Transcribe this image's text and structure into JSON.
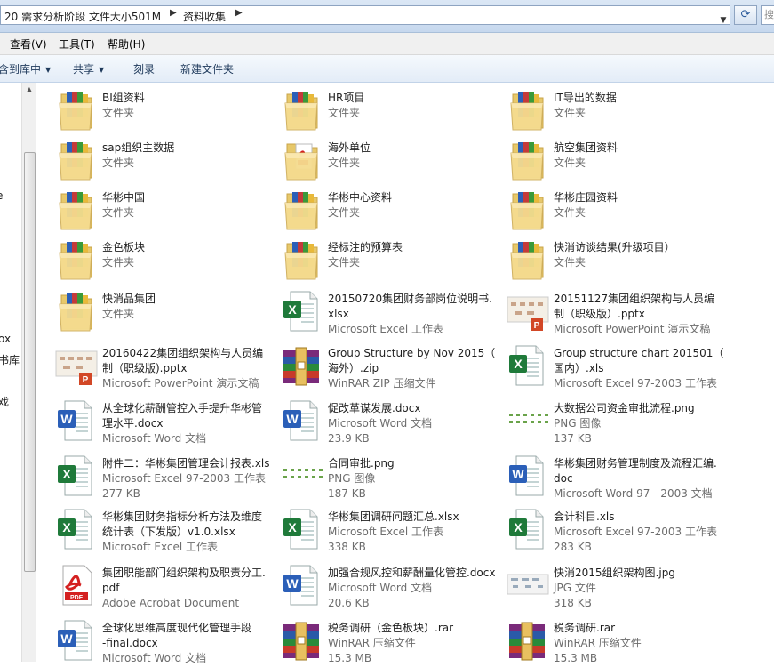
{
  "address": {
    "crumb1": "20 需求分析阶段 文件大小501M",
    "crumb2": "资料收集",
    "search_placeholder": "搜"
  },
  "menu": [
    "查看(V)",
    "工具(T)",
    "帮助(H)"
  ],
  "toolbar": {
    "include": "包含到库中",
    "share": "共享",
    "burn": "刻录",
    "new_folder": "新建文件夹"
  },
  "nav_fragments": [
    "e",
    "ox",
    "书库",
    "戏"
  ],
  "items": [
    {
      "l1": "BI组资料",
      "l2": "",
      "l3": "文件夹",
      "icon": "folder-icon"
    },
    {
      "l1": "HR项目",
      "l2": "",
      "l3": "文件夹",
      "icon": "folder-icon"
    },
    {
      "l1": "IT导出的数据",
      "l2": "",
      "l3": "文件夹",
      "icon": "folder-icon"
    },
    {
      "l1": "sap组织主数据",
      "l2": "",
      "l3": "文件夹",
      "icon": "folder-icon"
    },
    {
      "l1": "海外单位",
      "l2": "",
      "l3": "文件夹",
      "icon": "folder-pdf-icon"
    },
    {
      "l1": "航空集团资料",
      "l2": "",
      "l3": "文件夹",
      "icon": "folder-icon"
    },
    {
      "l1": "华彬中国",
      "l2": "",
      "l3": "文件夹",
      "icon": "folder-icon"
    },
    {
      "l1": "华彬中心资料",
      "l2": "",
      "l3": "文件夹",
      "icon": "folder-icon"
    },
    {
      "l1": "华彬庄园资料",
      "l2": "",
      "l3": "文件夹",
      "icon": "folder-icon"
    },
    {
      "l1": "金色板块",
      "l2": "",
      "l3": "文件夹",
      "icon": "folder-icon"
    },
    {
      "l1": "经标注的预算表",
      "l2": "",
      "l3": "文件夹",
      "icon": "folder-icon"
    },
    {
      "l1": "快消访谈结果(升级项目）",
      "l2": "",
      "l3": "文件夹",
      "icon": "folder-icon"
    },
    {
      "l1": "快消品集团",
      "l2": "",
      "l3": "文件夹",
      "icon": "folder-icon"
    },
    {
      "l1": "20150720集团财务部岗位说明书.",
      "l2": "xlsx",
      "l3": "Microsoft Excel 工作表",
      "icon": "excel-icon"
    },
    {
      "l1": "20151127集团组织架构与人员编",
      "l2": "制（职级版）.pptx",
      "l3": "Microsoft PowerPoint 演示文稿",
      "icon": "ppt-thumb-icon"
    },
    {
      "l1": "20160422集团组织架构与人员编",
      "l2": "制（职级版).pptx",
      "l3": "Microsoft PowerPoint 演示文稿",
      "icon": "ppt-thumb-icon"
    },
    {
      "l1": "Group Structure by Nov 2015（",
      "l2": "海外）.zip",
      "l3": "WinRAR ZIP 压缩文件",
      "icon": "rar-icon"
    },
    {
      "l1": "Group structure chart 201501（",
      "l2": "国内）.xls",
      "l3": "Microsoft Excel 97-2003 工作表",
      "icon": "excel-icon"
    },
    {
      "l1": "从全球化薪酬管控入手提升华彬管",
      "l2": "理水平.docx",
      "l3": "Microsoft Word 文档",
      "icon": "word-icon"
    },
    {
      "l1": "促改革谋发展.docx",
      "l2": "Microsoft Word 文档",
      "l3": "23.9 KB",
      "icon": "word-icon"
    },
    {
      "l1": "大数据公司资金审批流程.png",
      "l2": "PNG 图像",
      "l3": "137 KB",
      "icon": "png-thumb-icon"
    },
    {
      "l1": "附件二：华彬集团管理会计报表.xls",
      "l2": "Microsoft Excel 97-2003 工作表",
      "l3": "277 KB",
      "icon": "excel-icon"
    },
    {
      "l1": "合同审批.png",
      "l2": "PNG 图像",
      "l3": "187 KB",
      "icon": "png-thumb-icon"
    },
    {
      "l1": "华彬集团财务管理制度及流程汇编.",
      "l2": "doc",
      "l3": "Microsoft Word 97 - 2003 文档",
      "icon": "word-icon"
    },
    {
      "l1": "华彬集团财务指标分析方法及维度",
      "l2": "统计表（下发版）v1.0.xlsx",
      "l3": "Microsoft Excel 工作表",
      "icon": "excel-icon"
    },
    {
      "l1": "华彬集团调研问题汇总.xlsx",
      "l2": "Microsoft Excel 工作表",
      "l3": "338 KB",
      "icon": "excel-icon"
    },
    {
      "l1": "会计科目.xls",
      "l2": "Microsoft Excel 97-2003 工作表",
      "l3": "283 KB",
      "icon": "excel-icon"
    },
    {
      "l1": "集团职能部门组织架构及职责分工.",
      "l2": "pdf",
      "l3": "Adobe Acrobat Document",
      "icon": "pdf-icon"
    },
    {
      "l1": "加强合规风控和薪酬量化管控.docx",
      "l2": "Microsoft Word 文档",
      "l3": "20.6 KB",
      "icon": "word-icon"
    },
    {
      "l1": "快消2015组织架构图.jpg",
      "l2": "JPG 文件",
      "l3": "318 KB",
      "icon": "jpg-thumb-icon"
    },
    {
      "l1": "全球化思维高度现代化管理手段",
      "l2": "-final.docx",
      "l3": "Microsoft Word 文档",
      "icon": "word-icon"
    },
    {
      "l1": "税务调研（金色板块）.rar",
      "l2": "WinRAR 压缩文件",
      "l3": "15.3 MB",
      "icon": "rar-icon"
    },
    {
      "l1": "税务调研.rar",
      "l2": "WinRAR 压缩文件",
      "l3": "15.3 MB",
      "icon": "rar-icon"
    }
  ]
}
